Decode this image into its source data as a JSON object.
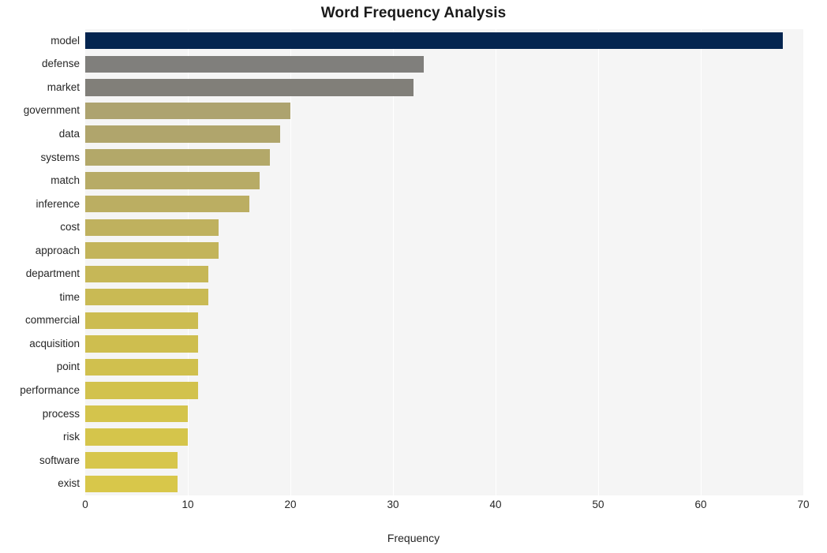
{
  "chart_data": {
    "type": "bar",
    "orientation": "horizontal",
    "title": "Word Frequency Analysis",
    "xlabel": "Frequency",
    "ylabel": "",
    "xlim": [
      0,
      70
    ],
    "ylim": [
      0,
      20
    ],
    "grid": true,
    "legend": false,
    "xticks": [
      "0",
      "10",
      "20",
      "30",
      "40",
      "50",
      "60",
      "70"
    ],
    "xtick_values": [
      0,
      10,
      20,
      30,
      40,
      50,
      60,
      70
    ],
    "categories": [
      "model",
      "defense",
      "market",
      "government",
      "data",
      "systems",
      "match",
      "inference",
      "cost",
      "approach",
      "department",
      "time",
      "commercial",
      "acquisition",
      "point",
      "performance",
      "process",
      "risk",
      "software",
      "exist"
    ],
    "values": [
      68,
      33,
      32,
      20,
      19,
      18,
      17,
      16,
      13,
      13,
      12,
      12,
      11,
      11,
      11,
      11,
      10,
      10,
      9,
      9
    ],
    "bar_colors": [
      "#042550",
      "#807f7c",
      "#817f79",
      "#ada36f",
      "#b0a56c",
      "#b3a869",
      "#b7ab66",
      "#bbae62",
      "#bfb15e",
      "#c3b45a",
      "#c6b757",
      "#c9ba54",
      "#ccbc51",
      "#cebe4f",
      "#d0c04e",
      "#d2c24d",
      "#d4c44c",
      "#d5c54b",
      "#d7c64b",
      "#d8c74a"
    ],
    "plot_background": "#f5f5f5",
    "grid_color": "#ffffff",
    "figure_background": "#ffffff",
    "text_color": "#262626"
  }
}
